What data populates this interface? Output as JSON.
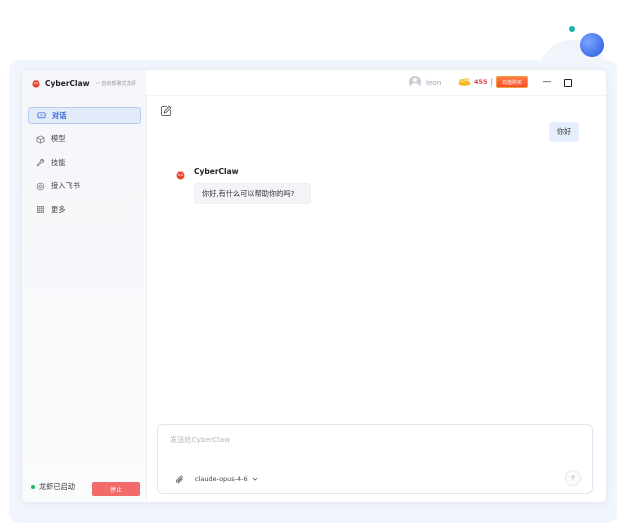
{
  "app": {
    "name": "CyberClaw",
    "subtitle": "~ 自动部署式龙虾"
  },
  "nav": {
    "items": [
      {
        "label": "对话",
        "icon": "chat-bubble-icon",
        "active": true
      },
      {
        "label": "模型",
        "icon": "cube-icon",
        "active": false
      },
      {
        "label": "技能",
        "icon": "wrench-icon",
        "active": false
      },
      {
        "label": "接入飞书",
        "icon": "connect-icon",
        "active": false
      },
      {
        "label": "更多",
        "icon": "grid-icon",
        "active": false
      }
    ]
  },
  "status": {
    "text": "龙虾已启动",
    "stop_label": "停止",
    "dot_color": "#22b35e"
  },
  "header": {
    "username": "leon",
    "coins": "455",
    "separator": "|",
    "buy_label": "充值购买",
    "minimize_glyph": "—"
  },
  "chat": {
    "messages": [
      {
        "role": "user",
        "text": "你好"
      },
      {
        "role": "bot",
        "sender": "CyberClaw",
        "text": "你好,有什么可以帮助你的吗?"
      }
    ]
  },
  "composer": {
    "placeholder": "发送给CyberClaw",
    "value": "",
    "model": "claude-opus-4-6"
  },
  "colors": {
    "accent": "#2f5fd4",
    "active_bg": "#e3ebfb",
    "stop": "#f26b6b",
    "coin": "#e0424c",
    "user_bubble": "#e6eefc"
  }
}
